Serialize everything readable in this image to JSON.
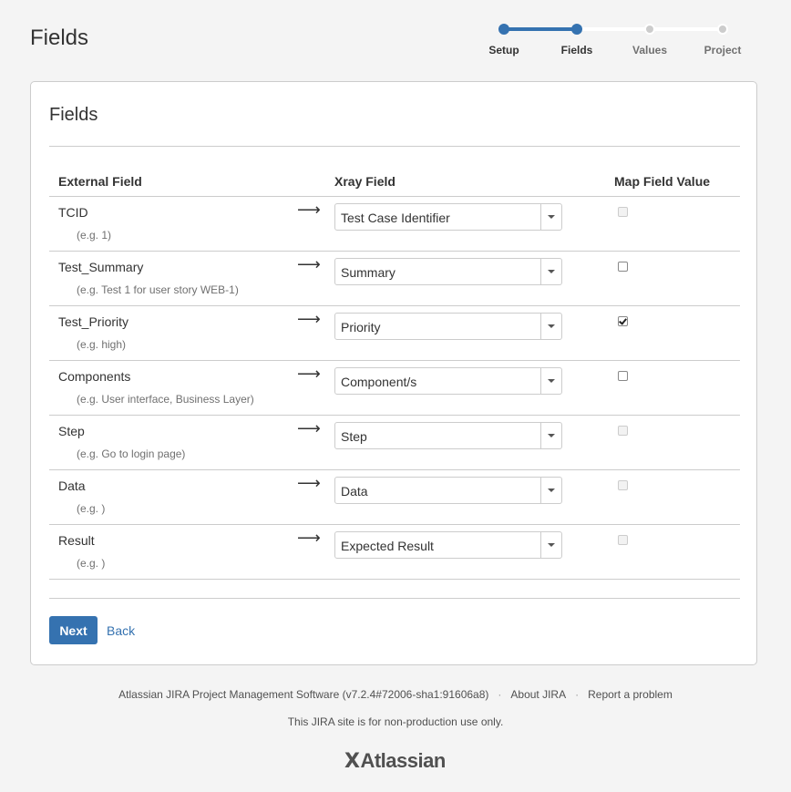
{
  "header": {
    "title": "Fields"
  },
  "tracker": {
    "steps": [
      "Setup",
      "Fields",
      "Values",
      "Project"
    ]
  },
  "panel": {
    "title": "Fields",
    "columns": {
      "external": "External Field",
      "xray": "Xray Field",
      "map": "Map Field Value"
    },
    "arrow": "⟶",
    "rows": [
      {
        "external": "TCID",
        "example": "(e.g. 1)",
        "xray": "Test Case Identifier",
        "map_checked": false,
        "map_enabled": false
      },
      {
        "external": "Test_Summary",
        "example": "(e.g. Test 1 for user story WEB-1)",
        "xray": "Summary",
        "map_checked": false,
        "map_enabled": true
      },
      {
        "external": "Test_Priority",
        "example": "(e.g. high)",
        "xray": "Priority",
        "map_checked": true,
        "map_enabled": true
      },
      {
        "external": "Components",
        "example": "(e.g. User interface, Business Layer)",
        "xray": "Component/s",
        "map_checked": false,
        "map_enabled": true
      },
      {
        "external": "Step",
        "example": "(e.g. Go to login page)",
        "xray": "Step",
        "map_checked": false,
        "map_enabled": false
      },
      {
        "external": "Data",
        "example": "(e.g. )",
        "xray": "Data",
        "map_checked": false,
        "map_enabled": false
      },
      {
        "external": "Result",
        "example": "(e.g. )",
        "xray": "Expected Result",
        "map_checked": false,
        "map_enabled": false
      }
    ],
    "next_label": "Next",
    "back_label": "Back"
  },
  "footer": {
    "software": "Atlassian JIRA Project Management Software (v7.2.4#72006-sha1:91606a8)",
    "about": "About JIRA",
    "report": "Report a problem",
    "notice": "This JIRA site is for non-production use only.",
    "logo": "Atlassian"
  },
  "colors": {
    "accent": "#3572b0",
    "background": "#f4f4f4"
  }
}
